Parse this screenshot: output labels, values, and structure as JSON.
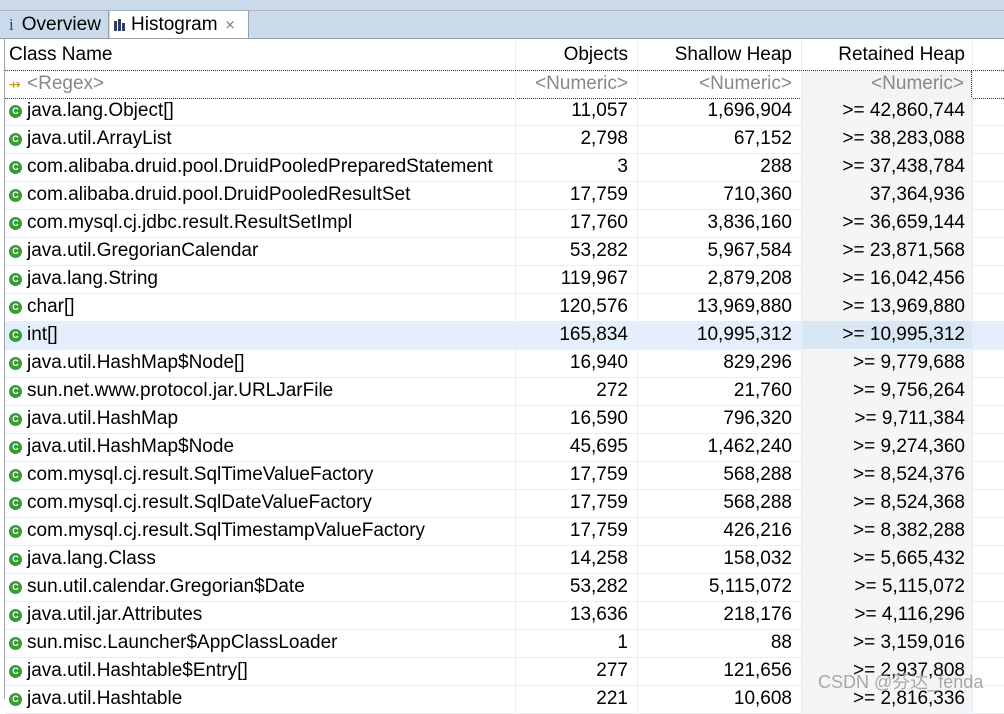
{
  "tabs": [
    {
      "label": "Overview",
      "icon": "info-icon",
      "active": false
    },
    {
      "label": "Histogram",
      "icon": "histogram-icon",
      "active": true,
      "closable": true
    }
  ],
  "columns": {
    "class_name": "Class Name",
    "objects": "Objects",
    "shallow_heap": "Shallow Heap",
    "retained_heap": "Retained Heap"
  },
  "filter": {
    "class_name_placeholder": "<Regex>",
    "objects_placeholder": "<Numeric>",
    "shallow_placeholder": "<Numeric>",
    "retained_placeholder": "<Numeric>"
  },
  "rows": [
    {
      "name": "java.lang.Object[]",
      "objects": "11,057",
      "shallow": "1,696,904",
      "retained": ">= 42,860,744"
    },
    {
      "name": "java.util.ArrayList",
      "objects": "2,798",
      "shallow": "67,152",
      "retained": ">= 38,283,088"
    },
    {
      "name": "com.alibaba.druid.pool.DruidPooledPreparedStatement",
      "objects": "3",
      "shallow": "288",
      "retained": ">= 37,438,784"
    },
    {
      "name": "com.alibaba.druid.pool.DruidPooledResultSet",
      "objects": "17,759",
      "shallow": "710,360",
      "retained": "37,364,936"
    },
    {
      "name": "com.mysql.cj.jdbc.result.ResultSetImpl",
      "objects": "17,760",
      "shallow": "3,836,160",
      "retained": ">= 36,659,144"
    },
    {
      "name": "java.util.GregorianCalendar",
      "objects": "53,282",
      "shallow": "5,967,584",
      "retained": ">= 23,871,568"
    },
    {
      "name": "java.lang.String",
      "objects": "119,967",
      "shallow": "2,879,208",
      "retained": ">= 16,042,456"
    },
    {
      "name": "char[]",
      "objects": "120,576",
      "shallow": "13,969,880",
      "retained": ">= 13,969,880"
    },
    {
      "name": "int[]",
      "objects": "165,834",
      "shallow": "10,995,312",
      "retained": ">= 10,995,312",
      "selected": true
    },
    {
      "name": "java.util.HashMap$Node[]",
      "objects": "16,940",
      "shallow": "829,296",
      "retained": ">= 9,779,688"
    },
    {
      "name": "sun.net.www.protocol.jar.URLJarFile",
      "objects": "272",
      "shallow": "21,760",
      "retained": ">= 9,756,264"
    },
    {
      "name": "java.util.HashMap",
      "objects": "16,590",
      "shallow": "796,320",
      "retained": ">= 9,711,384"
    },
    {
      "name": "java.util.HashMap$Node",
      "objects": "45,695",
      "shallow": "1,462,240",
      "retained": ">= 9,274,360"
    },
    {
      "name": "com.mysql.cj.result.SqlTimeValueFactory",
      "objects": "17,759",
      "shallow": "568,288",
      "retained": ">= 8,524,376"
    },
    {
      "name": "com.mysql.cj.result.SqlDateValueFactory",
      "objects": "17,759",
      "shallow": "568,288",
      "retained": ">= 8,524,368"
    },
    {
      "name": "com.mysql.cj.result.SqlTimestampValueFactory",
      "objects": "17,759",
      "shallow": "426,216",
      "retained": ">= 8,382,288"
    },
    {
      "name": "java.lang.Class",
      "objects": "14,258",
      "shallow": "158,032",
      "retained": ">= 5,665,432"
    },
    {
      "name": "sun.util.calendar.Gregorian$Date",
      "objects": "53,282",
      "shallow": "5,115,072",
      "retained": ">= 5,115,072"
    },
    {
      "name": "java.util.jar.Attributes",
      "objects": "13,636",
      "shallow": "218,176",
      "retained": ">= 4,116,296"
    },
    {
      "name": "sun.misc.Launcher$AppClassLoader",
      "objects": "1",
      "shallow": "88",
      "retained": ">= 3,159,016"
    },
    {
      "name": "java.util.Hashtable$Entry[]",
      "objects": "277",
      "shallow": "121,656",
      "retained": ">= 2,937,808"
    },
    {
      "name": "java.util.Hashtable",
      "objects": "221",
      "shallow": "10,608",
      "retained": ">= 2,816,336"
    }
  ],
  "watermark": "CSDN @芬达_fenda",
  "colors": {
    "tabbar_bg": "#cbdaeb",
    "selected_row": "#e3f0fb",
    "class_icon": "#3a9a3a",
    "retained_col_bg": "#f5f5f5"
  }
}
